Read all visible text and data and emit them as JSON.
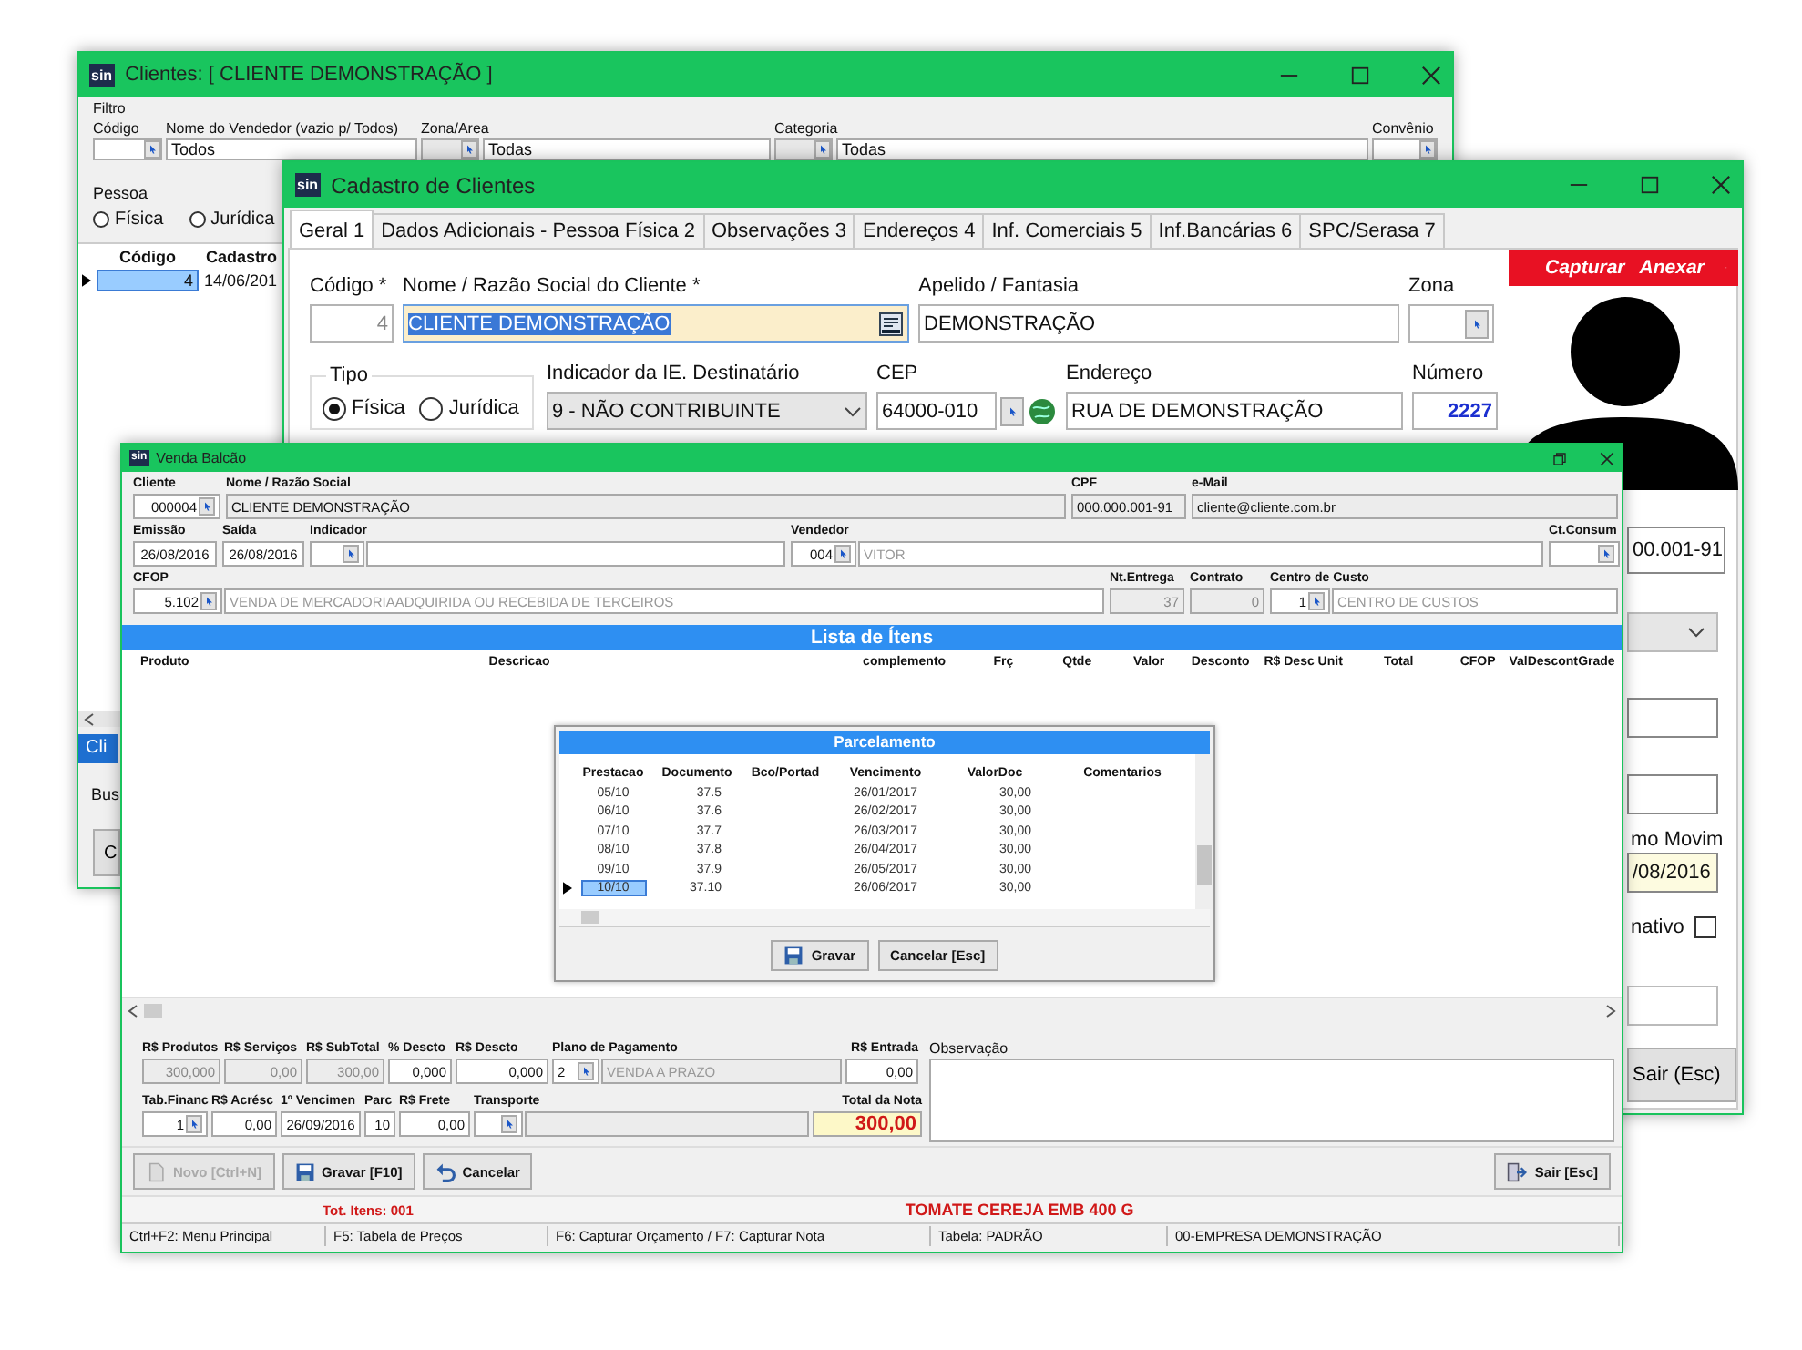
{
  "clientes_window": {
    "logo": "sin",
    "title": "Clientes: [ CLIENTE DEMONSTRAÇÃO ]",
    "filter_label": "Filtro",
    "filters": [
      {
        "label": "Código",
        "kind": "code"
      },
      {
        "label": "Nome do Vendedor (vazio p/ Todos)",
        "kind": "text",
        "value": "Todos"
      },
      {
        "label": "Zona/Area",
        "kind": "code_desc",
        "value": "Todas"
      },
      {
        "label": "Categoria",
        "kind": "code_desc",
        "value": "Todas"
      },
      {
        "label": "Convênio",
        "kind": "code"
      }
    ],
    "pessoa": {
      "label": "Pessoa",
      "options": [
        {
          "label": "Física",
          "selected": false
        },
        {
          "label": "Jurídica",
          "selected": false
        }
      ]
    },
    "table": {
      "columns": [
        "Código",
        "Cadastro"
      ],
      "rows": [
        {
          "cells": [
            "4",
            "14/06/201"
          ],
          "selected": true
        }
      ]
    },
    "bottom_tab": {
      "label": "Cli",
      "selected": true
    },
    "search_label": "Bus",
    "button": "C"
  },
  "cadastro_window": {
    "logo": "sin",
    "title": "Cadastro de Clientes",
    "tabs": [
      {
        "label": "Geral 1",
        "selected": true
      },
      {
        "label": "Dados Adicionais - Pessoa Física 2",
        "selected": false
      },
      {
        "label": "Observações 3",
        "selected": false
      },
      {
        "label": "Endereços 4",
        "selected": false
      },
      {
        "label": "Inf. Comerciais 5",
        "selected": false
      },
      {
        "label": "Inf.Bancárias 6",
        "selected": false
      },
      {
        "label": "SPC/Serasa 7",
        "selected": false
      }
    ],
    "codigo": {
      "label": "Código *",
      "value": "4"
    },
    "nome": {
      "label": "Nome / Razão Social do Cliente *",
      "value": "CLIENTE DEMONSTRAÇÃO",
      "highlighted": true
    },
    "apelido": {
      "label": "Apelido / Fantasia",
      "value": "DEMONSTRAÇÃO"
    },
    "zona": {
      "label": "Zona"
    },
    "tipo": {
      "label": "Tipo",
      "options": [
        {
          "label": "Física",
          "selected": true
        },
        {
          "label": "Jurídica",
          "selected": false
        }
      ]
    },
    "indicador": {
      "label": "Indicador da IE. Destinatário",
      "value": "9 - NÃO CONTRIBUINTE"
    },
    "cep": {
      "label": "CEP",
      "value": "64000-010"
    },
    "endereco": {
      "label": "Endereço",
      "value": "RUA DE DEMONSTRAÇÃO"
    },
    "numero": {
      "label": "Número",
      "value": "2227"
    },
    "photo_actions": [
      "Capturar",
      "Anexar"
    ],
    "side": {
      "cpf_fragment": "00.001-91",
      "movim_label": "mo Movim",
      "movim_date": "/08/2016",
      "inativo": {
        "label": "nativo",
        "checked": false
      },
      "exit_button": "Sair (Esc)"
    }
  },
  "venda_window": {
    "logo": "sin",
    "title": "Venda Balcão",
    "header_rows": [
      [
        {
          "label": "Cliente",
          "kind": "code",
          "code": "000004",
          "lookup": true
        },
        {
          "label": "Nome / Razão Social",
          "kind": "readonly_left",
          "value": "CLIENTE DEMONSTRAÇÃO"
        },
        {
          "label": "CPF",
          "kind": "readonly_left",
          "value": "000.000.001-91"
        },
        {
          "label": "e-Mail",
          "kind": "readonly_left",
          "value": "cliente@cliente.com.br"
        }
      ],
      [
        {
          "label": "Emissão",
          "kind": "text",
          "value": "26/08/2016"
        },
        {
          "label": "Saída",
          "kind": "text",
          "value": "26/08/2016"
        },
        {
          "label": "Indicador",
          "kind": "code_desc",
          "lookup": true
        },
        {
          "label": "Vendedor",
          "kind": "code_desc",
          "code": "004",
          "value": "VITOR",
          "lookup": true
        },
        {
          "label": "Ct.Consum",
          "kind": "code",
          "lookup": true
        }
      ],
      [
        {
          "label": "CFOP",
          "kind": "code_desc",
          "code": "5.102",
          "value": "VENDA DE MERCADORIAADQUIRIDA OU RECEBIDA DE TERCEIROS",
          "lookup": true
        },
        {
          "label": "Nt.Entrega",
          "kind": "readonly",
          "value": "37"
        },
        {
          "label": "Contrato",
          "kind": "readonly",
          "value": "0"
        },
        {
          "label": "Centro de Custo",
          "kind": "code_desc",
          "code": "1",
          "value": "CENTRO DE CUSTOS",
          "lookup": true
        }
      ]
    ],
    "list_title": "Lista de Ítens",
    "item_columns": [
      "Produto",
      "Descricao",
      "complemento",
      "Frç",
      "Qtde",
      "Valor",
      "Desconto",
      "R$ Desc Unit",
      "Total",
      "CFOP",
      "ValDescont",
      "Grade"
    ],
    "parcelamento": {
      "title": "Parcelamento",
      "columns": [
        "Prestacao",
        "Documento",
        "Bco/Portad",
        "Vencimento",
        "ValorDoc",
        "Comentarios"
      ],
      "rows": [
        {
          "cells": [
            "05/10",
            "37.5",
            "",
            "26/01/2017",
            "30,00",
            ""
          ],
          "selected": false
        },
        {
          "cells": [
            "06/10",
            "37.6",
            "",
            "26/02/2017",
            "30,00",
            ""
          ],
          "selected": false
        },
        {
          "cells": [
            "07/10",
            "37.7",
            "",
            "26/03/2017",
            "30,00",
            ""
          ],
          "selected": false
        },
        {
          "cells": [
            "08/10",
            "37.8",
            "",
            "26/04/2017",
            "30,00",
            ""
          ],
          "selected": false
        },
        {
          "cells": [
            "09/10",
            "37.9",
            "",
            "26/05/2017",
            "30,00",
            ""
          ],
          "selected": false
        },
        {
          "cells": [
            "10/10",
            "37.10",
            "",
            "26/06/2017",
            "30,00",
            ""
          ],
          "selected": true
        }
      ],
      "buttons": [
        "Gravar",
        "Cancelar [Esc]"
      ]
    },
    "totals": [
      [
        {
          "label": "R$ Produtos",
          "kind": "readonly",
          "value": "300,000"
        },
        {
          "label": "R$ Serviços",
          "kind": "readonly",
          "value": "0,00"
        },
        {
          "label": "R$ SubTotal",
          "kind": "readonly",
          "value": "300,00"
        },
        {
          "label": "% Descto",
          "kind": "number",
          "value": "0,000"
        },
        {
          "label": "R$ Descto",
          "kind": "number",
          "value": "0,000"
        },
        {
          "label": "Plano de Pagamento",
          "kind": "code_desc",
          "code": "2",
          "value": "VENDA  A PRAZO",
          "lookup": true
        },
        {
          "label": "R$ Entrada",
          "kind": "number",
          "value": "0,00"
        }
      ],
      [
        {
          "label": "Tab.Financ",
          "kind": "code",
          "code": "1",
          "lookup": true
        },
        {
          "label": "R$ Acrésc",
          "kind": "number",
          "value": "0,00"
        },
        {
          "label": "1º Vencimen",
          "kind": "text",
          "value": "26/09/2016"
        },
        {
          "label": "Parc",
          "kind": "number",
          "value": "10"
        },
        {
          "label": "R$ Frete",
          "kind": "number",
          "value": "0,00"
        },
        {
          "label": "Transporte",
          "kind": "code_desc",
          "lookup": true
        },
        {
          "label": "Total da Nota",
          "kind": "total",
          "value": "300,00"
        }
      ]
    ],
    "observacao_label": "Observação",
    "actions": [
      {
        "label": "Novo [Ctrl+N]",
        "disabled": true
      },
      {
        "label": "Gravar [F10]",
        "disabled": false
      },
      {
        "label": "Cancelar",
        "disabled": false
      }
    ],
    "exit_button": "Sair [Esc]",
    "status": {
      "items": "Tot. Itens: 001",
      "product": "TOMATE CEREJA EMB 400 G"
    },
    "status_bar": [
      "Ctrl+F2: Menu Principal",
      "F5: Tabela de Preços",
      "F6: Capturar Orçamento / F7: Capturar Nota",
      "Tabela: PADRÃO",
      "00-EMPRESA DEMONSTRAÇÃO"
    ]
  }
}
